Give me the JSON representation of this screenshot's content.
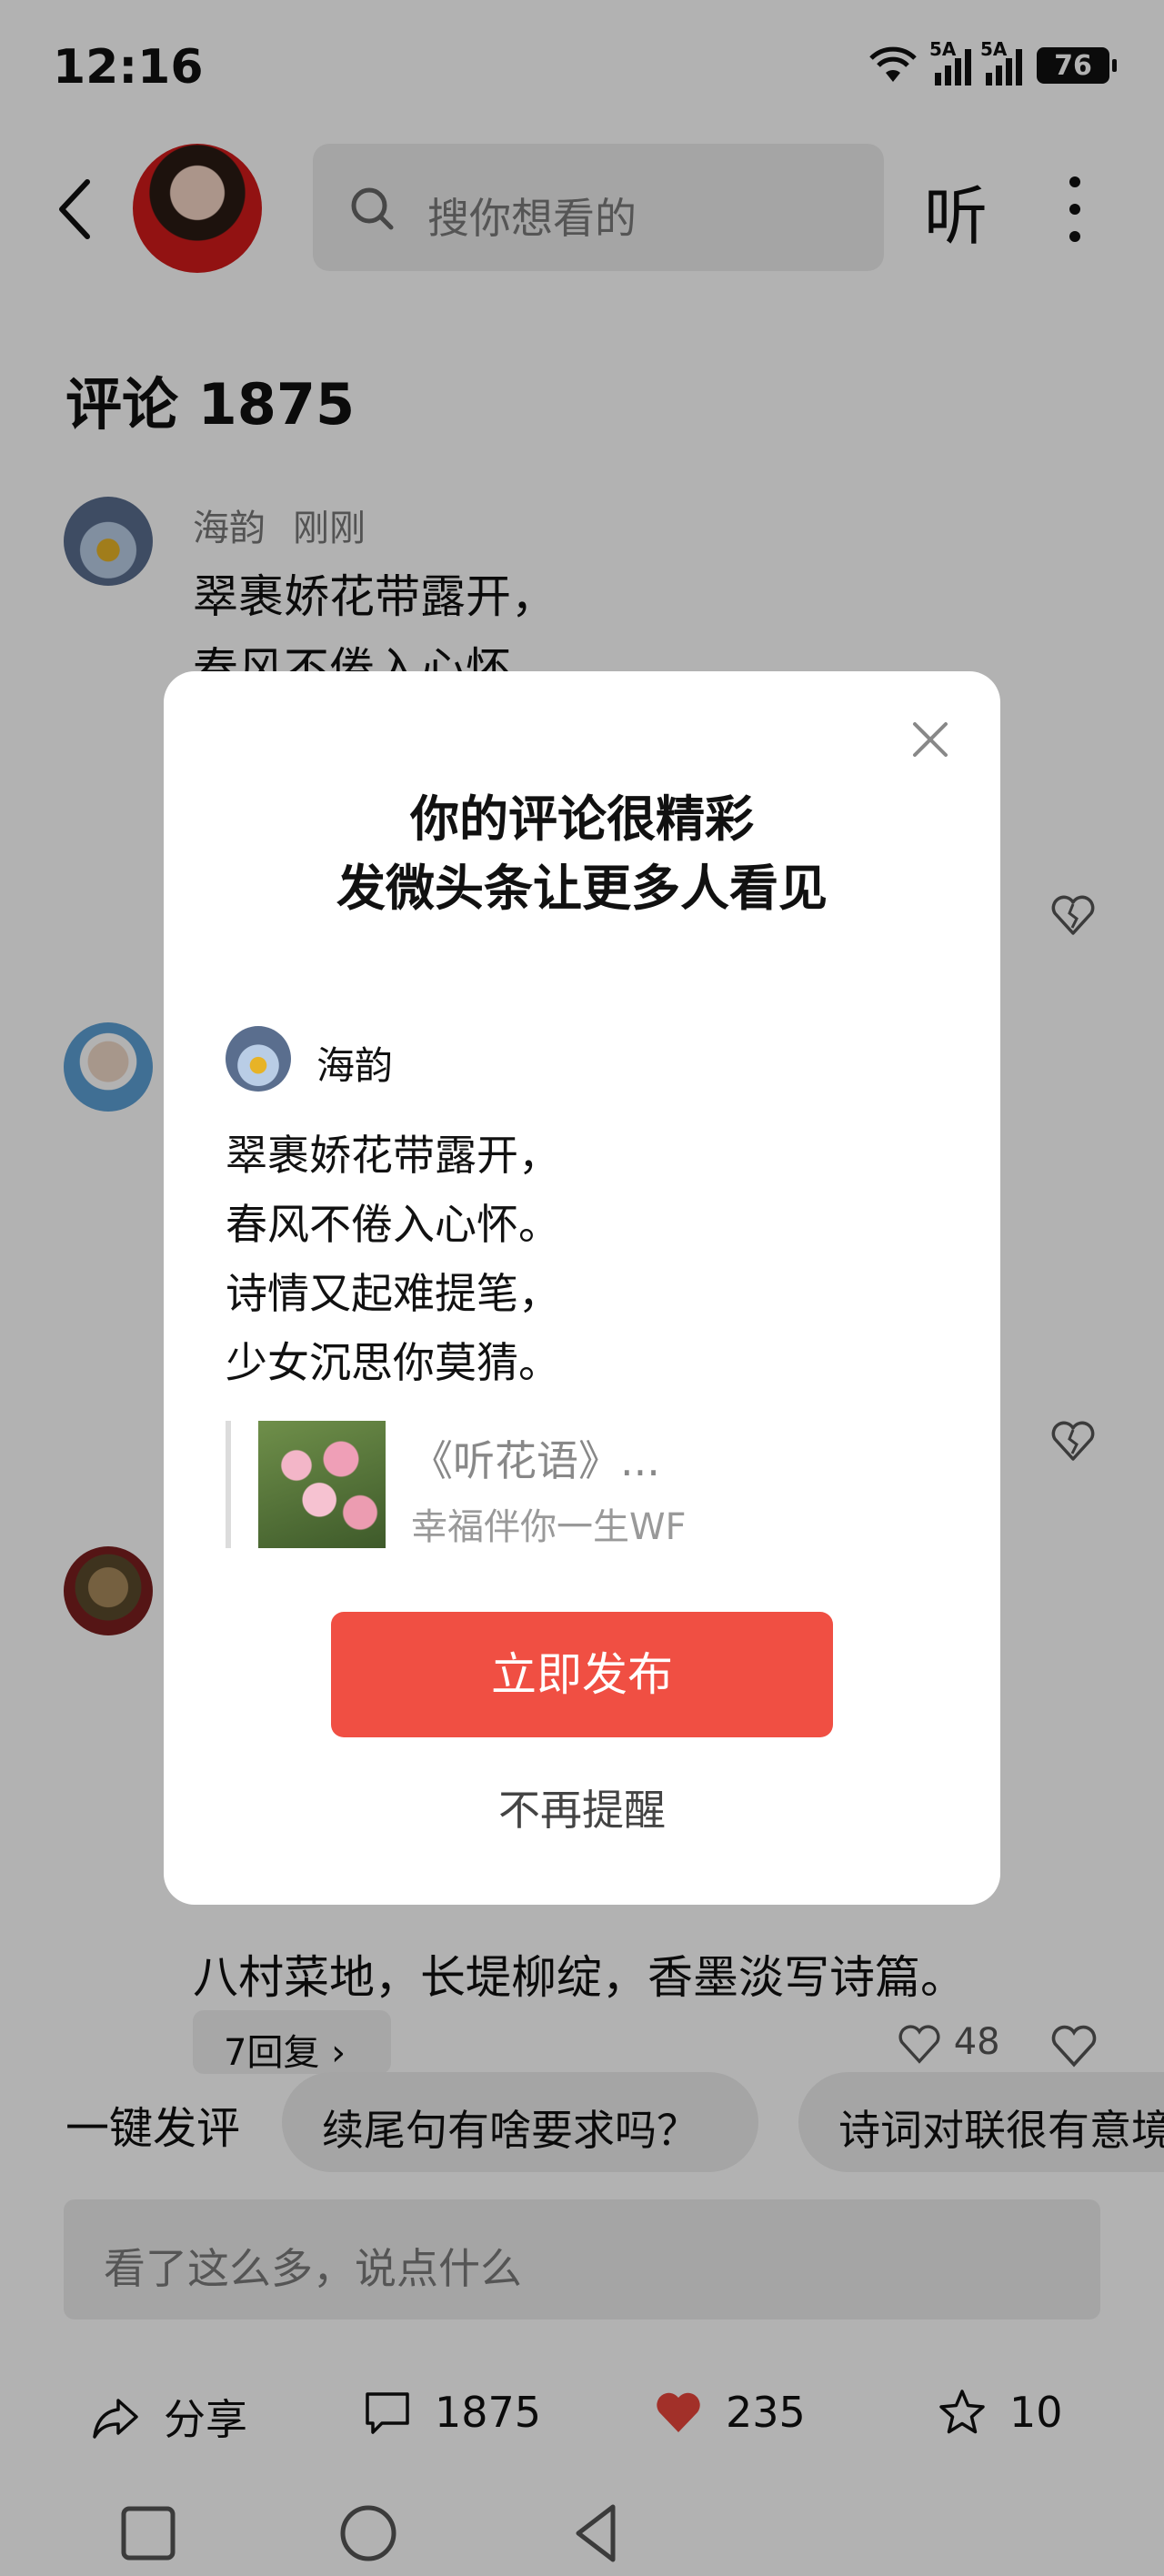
{
  "status_bar": {
    "time": "12:16",
    "battery": "76",
    "signal1_label": "5A",
    "signal2_label": "5A",
    "wifi_label": "7"
  },
  "header": {
    "search_placeholder": "搜你想看的",
    "listen_label": "听"
  },
  "comments": {
    "title": "评论 1875",
    "first": {
      "author": "海韵",
      "time": "刚刚",
      "line1": "翠裹娇花带露开，",
      "line2": "春风不倦入心怀"
    },
    "bottom_visible_text": "八村菜地，长堤柳绽，香墨淡写诗篇。",
    "reply_label": "7回复 ›",
    "like_partial": "48"
  },
  "quick_reply": {
    "label": "一键发评",
    "chips": [
      "续尾句有啥要求吗？",
      "诗词对联很有意境"
    ]
  },
  "input": {
    "placeholder": "看了这么多，说点什么"
  },
  "actions": {
    "share": "分享",
    "comments": "1875",
    "likes": "235",
    "favorites": "10"
  },
  "dialog": {
    "title_line1": "你的评论很精彩",
    "title_line2": "发微头条让更多人看见",
    "author": "海韵",
    "poem": [
      "翠裹娇花带露开，",
      "春风不倦入心怀。",
      "诗情又起难提笔，",
      "少女沉思你莫猜。"
    ],
    "quote_title": "《听花语》...",
    "quote_author": "幸福伴你一生WF",
    "publish_label": "立即发布",
    "dismiss_label": "不再提醒"
  },
  "colors": {
    "accent": "#f04f43",
    "like": "#e8453c",
    "overlay": "rgba(0,0,0,0.30)"
  }
}
